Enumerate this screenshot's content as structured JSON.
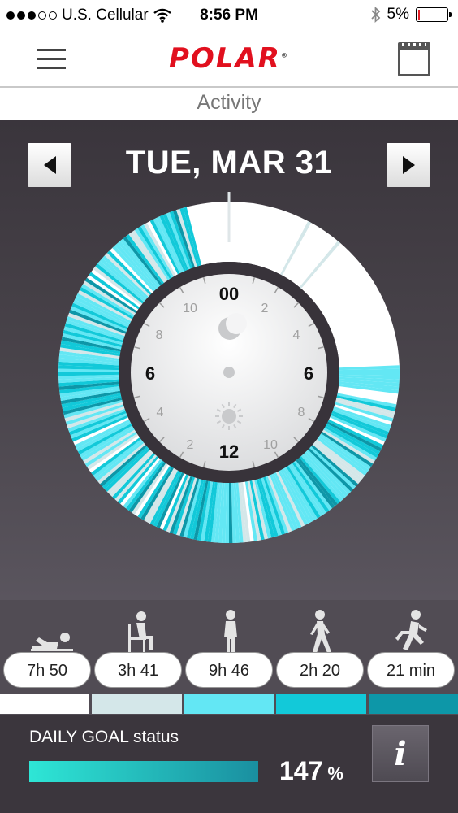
{
  "status_bar": {
    "carrier": "U.S. Cellular",
    "time": "8:56 PM",
    "battery": "5%",
    "battery_level": 0.05,
    "signal_bars_filled": 3,
    "signal_bars_total": 5
  },
  "header": {
    "logo": "POLAR",
    "menu_icon": "hamburger-icon",
    "calendar_icon": "calendar-icon"
  },
  "page_title": "Activity",
  "day_nav": {
    "date": "TUE, MAR 31",
    "prev_icon": "chevron-left-icon",
    "next_icon": "chevron-right-icon"
  },
  "clock": {
    "top_label": "00",
    "right_label": "6",
    "bottom_label": "12",
    "left_label": "6",
    "right_ticks": [
      "2",
      "4",
      "8",
      "10"
    ],
    "left_ticks": [
      "10",
      "8",
      "4",
      "2"
    ],
    "night_icon": "moon-icon",
    "day_icon": "sun-icon"
  },
  "activity_levels": [
    {
      "icon": "lying-down-icon",
      "duration": "7h 50",
      "color": "#ffffff"
    },
    {
      "icon": "sitting-icon",
      "duration": "3h 41",
      "color": "#d4e7e9"
    },
    {
      "icon": "standing-icon",
      "duration": "9h 46",
      "color": "#63e7f4"
    },
    {
      "icon": "walking-icon",
      "duration": "2h 20",
      "color": "#12c9d9"
    },
    {
      "icon": "running-icon",
      "duration": "21 min",
      "color": "#0d97a8"
    }
  ],
  "daily_goal": {
    "label": "DAILY GOAL status",
    "value": "147",
    "unit": "%",
    "progress": 1.0,
    "info_label": "i"
  },
  "colors": {
    "brand": "#e1101e",
    "panel_dark": "#3a353c",
    "accent_cyan": "#2ee6d6"
  }
}
